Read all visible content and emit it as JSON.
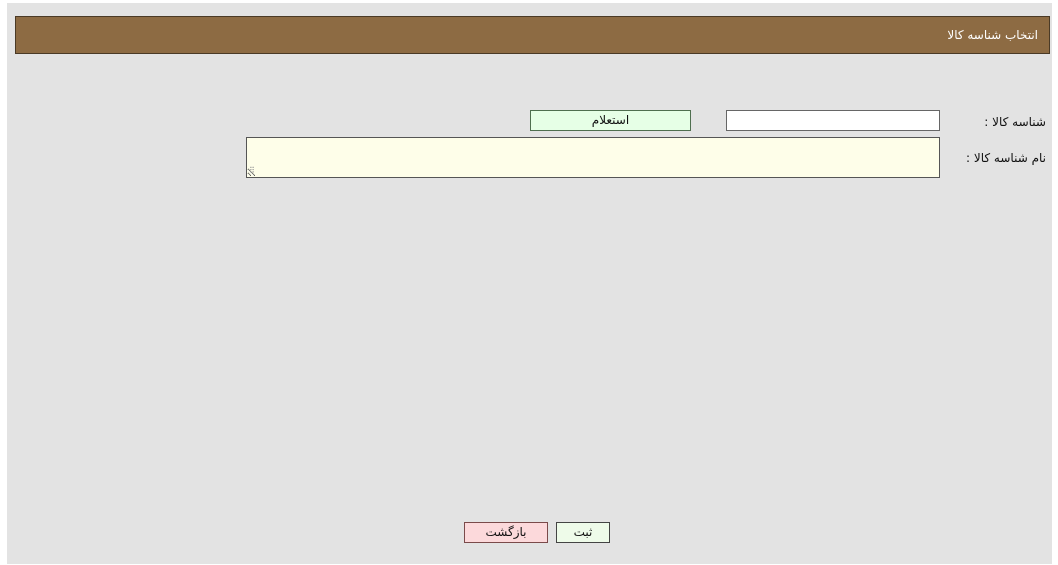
{
  "header": {
    "title": "انتخاب شناسه کالا"
  },
  "form": {
    "code_label": "شناسه کالا :",
    "code_value": "",
    "code_placeholder": "",
    "inquiry_label": "استعلام",
    "name_label": "نام شناسه کالا :",
    "name_value": ""
  },
  "footer": {
    "save_label": "ثبت",
    "back_label": "بازگشت"
  },
  "colors": {
    "title_bar": "#8d6b43",
    "page_background": "#e3e3e3",
    "inquiry_button": "#e6ffe6",
    "save_button": "#eefbe9",
    "back_button": "#fcd9db",
    "textarea_background": "#fefee9"
  }
}
